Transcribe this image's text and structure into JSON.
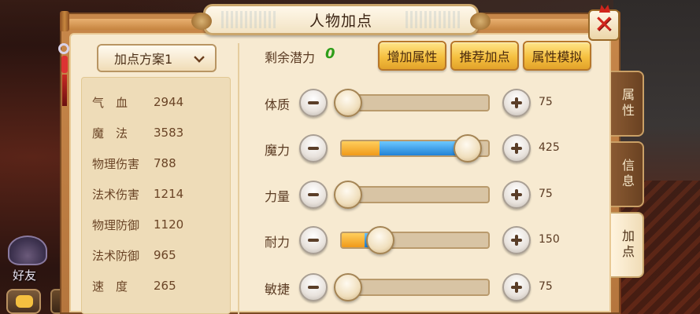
{
  "window": {
    "title": "人物加点"
  },
  "hud": {
    "friend_label": "好友"
  },
  "plan": {
    "selected": "加点方案1"
  },
  "stats": [
    {
      "name": "气　血",
      "value": "2944"
    },
    {
      "name": "魔　法",
      "value": "3583"
    },
    {
      "name": "物理伤害",
      "value": "788"
    },
    {
      "name": "法术伤害",
      "value": "1214"
    },
    {
      "name": "物理防御",
      "value": "1120"
    },
    {
      "name": "法术防御",
      "value": "965"
    },
    {
      "name": "速　度",
      "value": "265"
    }
  ],
  "potential": {
    "label": "剩余潜力",
    "value": "0"
  },
  "buttons": {
    "add_attr": "增加属性",
    "recommend": "推荐加点",
    "simulate": "属性模拟"
  },
  "attributes": [
    {
      "name": "体质",
      "value": "75",
      "orange_pct": 0,
      "blue_pct": 0,
      "knob_pct": 0.05
    },
    {
      "name": "魔力",
      "value": "425",
      "orange_pct": 0.25,
      "blue_pct": 0.58,
      "knob_pct": 0.85
    },
    {
      "name": "力量",
      "value": "75",
      "orange_pct": 0,
      "blue_pct": 0,
      "knob_pct": 0.05
    },
    {
      "name": "耐力",
      "value": "150",
      "orange_pct": 0.15,
      "blue_pct": 0.07,
      "knob_pct": 0.27
    },
    {
      "name": "敏捷",
      "value": "75",
      "orange_pct": 0,
      "blue_pct": 0,
      "knob_pct": 0.05
    }
  ],
  "tabs": [
    {
      "label": "属性",
      "active": false
    },
    {
      "label": "信息",
      "active": false
    },
    {
      "label": "加点",
      "active": true
    }
  ],
  "colors": {
    "potential_value": "#2e9e1a",
    "close_x": "#d0251c",
    "bar_orange": "#f09a1a",
    "bar_blue": "#2182d6"
  },
  "icons": {
    "close": "close-icon",
    "minus": "minus-icon",
    "plus": "plus-icon",
    "chevron": "chevron-down-icon"
  }
}
